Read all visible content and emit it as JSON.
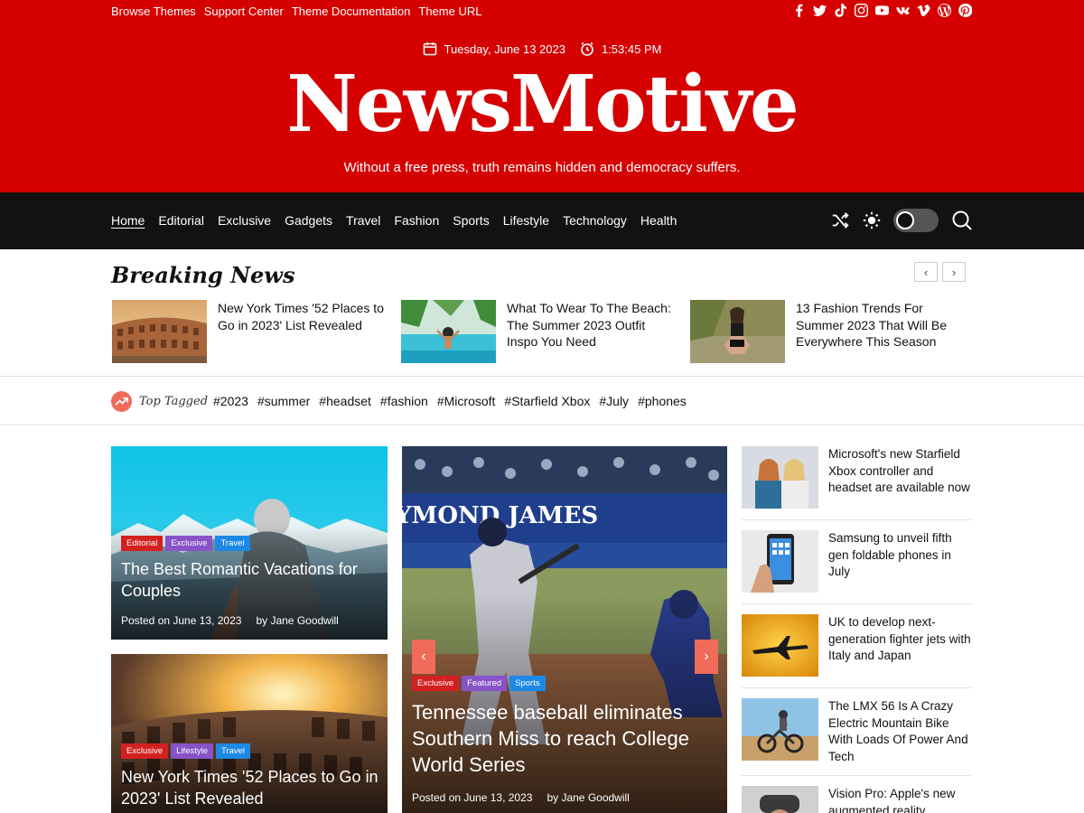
{
  "topbar": {
    "links": [
      "Browse Themes",
      "Support Center",
      "Theme Documentation",
      "Theme URL"
    ],
    "social_icons": [
      "facebook-icon",
      "twitter-icon",
      "tiktok-icon",
      "instagram-icon",
      "youtube-icon",
      "vk-icon",
      "vimeo-icon",
      "wordpress-icon",
      "pinterest-icon"
    ]
  },
  "header": {
    "date": "Tuesday, June 13 2023",
    "time": "1:53:45 PM",
    "site_title": "NewsMotive",
    "tagline": "Without a free press, truth remains hidden and democracy suffers.",
    "brand_color": "#d50000"
  },
  "nav": {
    "items": [
      "Home",
      "Editorial",
      "Exclusive",
      "Gadgets",
      "Travel",
      "Fashion",
      "Sports",
      "Lifestyle",
      "Technology",
      "Health"
    ],
    "active": "Home",
    "tools": [
      "shuffle-icon",
      "sun-icon",
      "dark-mode-toggle",
      "search-icon"
    ]
  },
  "breaking": {
    "title": "Breaking News",
    "items": [
      {
        "title": "New York Times '52 Places to Go in 2023' List Revealed"
      },
      {
        "title": "What To Wear To The Beach: The Summer 2023 Outfit Inspo You Need"
      },
      {
        "title": "13 Fashion Trends For Summer 2023 That Will Be Everywhere This Season"
      }
    ]
  },
  "tags": {
    "label": "Top Tagged",
    "items": [
      "#2023",
      "#summer",
      "#headset",
      "#fashion",
      "#Microsoft",
      "#Starfield Xbox",
      "#July",
      "#phones"
    ]
  },
  "cards": {
    "left_top": {
      "categories": [
        "Editorial",
        "Exclusive",
        "Travel"
      ],
      "title": "The Best Romantic Vacations for Couples",
      "date": "Posted on June 13, 2023",
      "author": "by Jane Goodwill"
    },
    "left_bottom": {
      "categories": [
        "Exclusive",
        "Lifestyle",
        "Travel"
      ],
      "title": "New York Times '52 Places to Go in 2023' List Revealed"
    },
    "featured": {
      "banner": "YMOND JAMES",
      "categories": [
        "Exclusive",
        "Featured",
        "Sports"
      ],
      "title": "Tennessee baseball eliminates Southern Miss to reach College World Series",
      "date": "Posted on June 13, 2023",
      "author": "by Jane Goodwill"
    }
  },
  "side_list": [
    {
      "title": "Microsoft's new Starfield Xbox controller and headset are available now"
    },
    {
      "title": "Samsung to unveil fifth gen foldable phones in July"
    },
    {
      "title": "UK to develop next-generation fighter jets with Italy and Japan"
    },
    {
      "title": "The LMX 56 Is A Crazy Electric Mountain Bike With Loads Of Power And Tech"
    },
    {
      "title": "Vision Pro: Apple's new augmented reality"
    }
  ]
}
